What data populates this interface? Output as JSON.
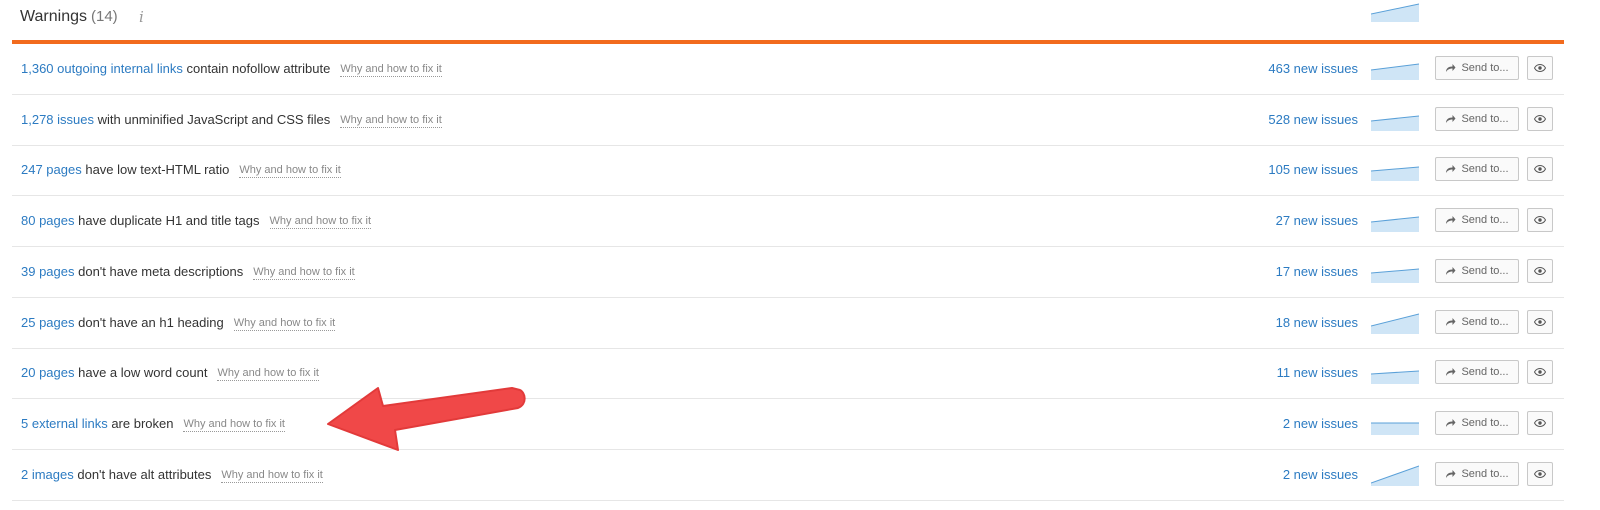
{
  "section": {
    "title": "Warnings",
    "count": "(14)",
    "info_icon": "info-icon"
  },
  "rows": [
    {
      "link": "1,360 outgoing internal links",
      "text": " contain nofollow attribute",
      "why": "Why and how to fix it",
      "new_issues": "463 new issues",
      "send": "Send to..."
    },
    {
      "link": "1,278 issues",
      "text": " with unminified JavaScript and CSS files",
      "why": "Why and how to fix it",
      "new_issues": "528 new issues",
      "send": "Send to..."
    },
    {
      "link": "247 pages",
      "text": " have low text-HTML ratio",
      "why": "Why and how to fix it",
      "new_issues": "105 new issues",
      "send": "Send to..."
    },
    {
      "link": "80 pages",
      "text": " have duplicate H1 and title tags",
      "why": "Why and how to fix it",
      "new_issues": "27 new issues",
      "send": "Send to..."
    },
    {
      "link": "39 pages",
      "text": " don't have meta descriptions",
      "why": "Why and how to fix it",
      "new_issues": "17 new issues",
      "send": "Send to..."
    },
    {
      "link": "25 pages",
      "text": " don't have an h1 heading",
      "why": "Why and how to fix it",
      "new_issues": "18 new issues",
      "send": "Send to..."
    },
    {
      "link": "20 pages",
      "text": " have a low word count",
      "why": "Why and how to fix it",
      "new_issues": "11 new issues",
      "send": "Send to..."
    },
    {
      "link": "5 external links",
      "text": " are broken",
      "why": "Why and how to fix it",
      "new_issues": "2 new issues",
      "send": "Send to..."
    },
    {
      "link": "2 images",
      "text": " don't have alt attributes",
      "why": "Why and how to fix it",
      "new_issues": "2 new issues",
      "send": "Send to..."
    }
  ],
  "colors": {
    "accent_orange": "#f26b1d",
    "link_blue": "#2c7bc2",
    "spark_fill": "#cfe5f6",
    "spark_line": "#5aa0d8",
    "annotation_arrow": "#f04848"
  }
}
